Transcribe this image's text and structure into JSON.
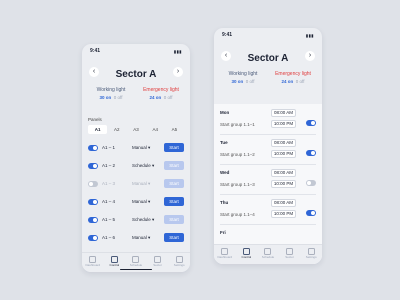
{
  "left": {
    "time": "9:41",
    "title": "Sector A",
    "prev": "‹",
    "next": "›",
    "working": {
      "label": "Working light",
      "on": "30 on",
      "off": "0 off"
    },
    "emergency": {
      "label": "Emergency light",
      "on": "24 on",
      "off": "0 off"
    },
    "panels_label": "Panels",
    "tabs": [
      "A1",
      "A2",
      "A3",
      "A4",
      "A5"
    ],
    "rows": [
      {
        "name": "A1 – 1",
        "mode": "Manual ▾",
        "button": "Start"
      },
      {
        "name": "A1 – 2",
        "mode": "Schedule ▾",
        "button": "Start"
      },
      {
        "name": "A1 – 3",
        "mode": "Manual ▾",
        "button": "Start"
      },
      {
        "name": "A1 – 4",
        "mode": "Manual ▾",
        "button": "Start"
      },
      {
        "name": "A1 – 5",
        "mode": "Schedule ▾",
        "button": "Start"
      },
      {
        "name": "A1 – 6",
        "mode": "Manual ▾",
        "button": "Start"
      }
    ],
    "tabbar": [
      "Dashboard",
      "Control",
      "Schedule",
      "Sector",
      "Settings"
    ]
  },
  "right": {
    "time": "9:41",
    "title": "Sector A",
    "prev": "‹",
    "next": "›",
    "working": {
      "label": "Working light",
      "on": "30 on",
      "off": "0 off"
    },
    "emergency": {
      "label": "Emergency light",
      "on": "24 on",
      "off": "0 off"
    },
    "schedule": [
      {
        "day": "Mon",
        "group": "Start group 1.1–1",
        "t1": "08:00 AM",
        "t2": "10:00 PM"
      },
      {
        "day": "Tue",
        "group": "Start group 1.1–2",
        "t1": "08:00 AM",
        "t2": "10:00 PM"
      },
      {
        "day": "Wed",
        "group": "Start group 1.1–3",
        "t1": "08:00 AM",
        "t2": "10:00 PM"
      },
      {
        "day": "Thu",
        "group": "Start group 1.1–4",
        "t1": "08:00 AM",
        "t2": "10:00 PM"
      },
      {
        "day": "Fri",
        "group": "",
        "t1": "",
        "t2": ""
      }
    ],
    "tabbar": [
      "Dashboard",
      "Control",
      "Schedule",
      "Sector",
      "Settings"
    ]
  }
}
